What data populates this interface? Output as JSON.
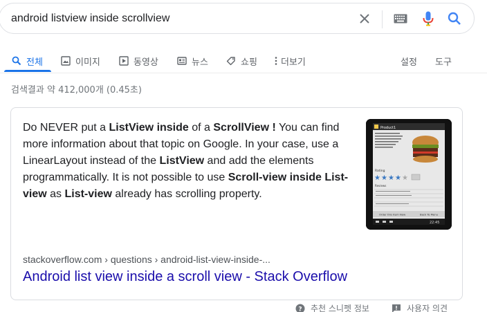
{
  "search": {
    "query": "android listview inside scrollview",
    "clear_icon": "close-icon",
    "keyboard_icon": "keyboard-icon",
    "voice_icon": "microphone-icon",
    "search_icon": "search-icon"
  },
  "tabs": [
    {
      "label": "전체",
      "icon": "search-icon",
      "active": true
    },
    {
      "label": "이미지",
      "icon": "image-icon",
      "active": false
    },
    {
      "label": "동영상",
      "icon": "video-icon",
      "active": false
    },
    {
      "label": "뉴스",
      "icon": "news-icon",
      "active": false
    },
    {
      "label": "쇼핑",
      "icon": "tag-icon",
      "active": false
    },
    {
      "label": "더보기",
      "icon": "more-vert-icon",
      "active": false
    }
  ],
  "tools": {
    "settings": "설정",
    "tools": "도구"
  },
  "result_stats": "검색결과 약 412,000개 (0.45초)",
  "snippet": {
    "parts": [
      {
        "t": "Do NEVER put a ",
        "b": false
      },
      {
        "t": "ListView inside",
        "b": true
      },
      {
        "t": " of a ",
        "b": false
      },
      {
        "t": "ScrollView !",
        "b": true
      },
      {
        "t": " You can find more information about that topic on Google. In your case, use a LinearLayout instead of the ",
        "b": false
      },
      {
        "t": "ListView",
        "b": true
      },
      {
        "t": " and add the elements programmatically. It is not possible to use ",
        "b": false
      },
      {
        "t": "Scroll-view inside",
        "b": true
      },
      {
        "t": " ",
        "b": false
      },
      {
        "t": "List-view",
        "b": true
      },
      {
        "t": " as ",
        "b": false
      },
      {
        "t": "List-view",
        "b": true
      },
      {
        "t": " already has scrolling property.",
        "b": false
      }
    ],
    "thumbnail": {
      "app_title": "Product1",
      "rating_label": "Rating",
      "reviews_label": "Reviews",
      "left_button": "Order this item Now",
      "right_button": "Back To Menu",
      "clock": "22:45"
    },
    "source": "stackoverflow.com › questions › android-list-view-inside-...",
    "title": "Android list view inside a scroll view - Stack Overflow"
  },
  "feedback": {
    "about": "추천 스니펫 정보",
    "report": "사용자 의견"
  },
  "colors": {
    "accent": "#1a73e8",
    "link": "#1a0dab",
    "mic_red": "#ea4335"
  }
}
